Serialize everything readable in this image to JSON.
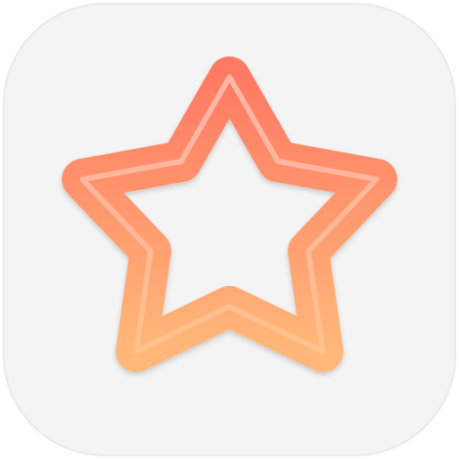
{
  "icon": {
    "name": "star-outline-icon",
    "colors": {
      "background": "#f4f4f4",
      "star_gradient_top": "#ff7a63",
      "star_gradient_bottom": "#ffb879",
      "star_highlight": "#ffd2b8"
    }
  }
}
